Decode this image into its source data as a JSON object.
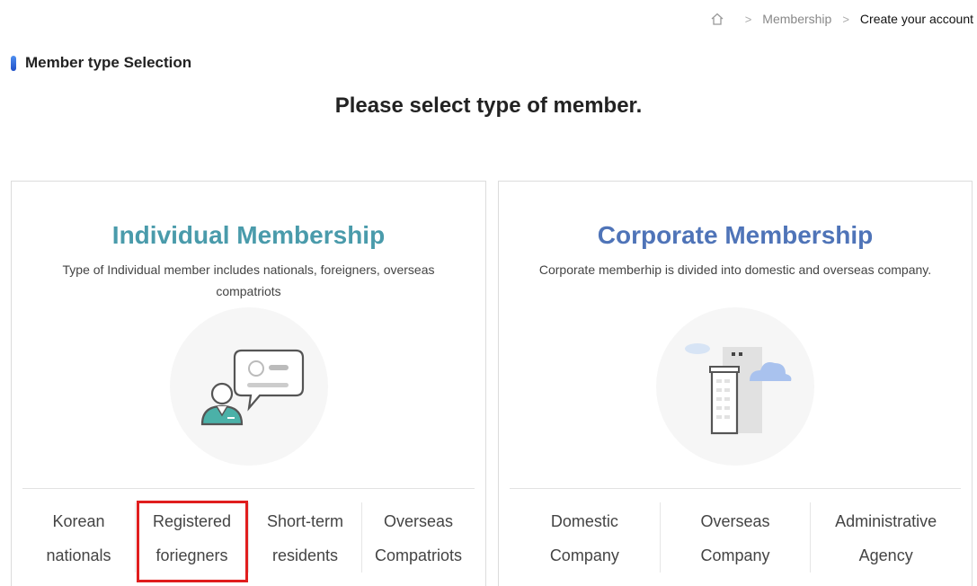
{
  "breadcrumb": {
    "home_icon": "home-icon",
    "separator": ">",
    "items": [
      "Membership",
      "Create your account"
    ]
  },
  "section_title": "Member type Selection",
  "page_title": "Please select type of member.",
  "colors": {
    "individual_title": "#4a9bab",
    "corporate_title": "#4f74b8",
    "highlight": "#e01e1e",
    "section_bar": "#1f4fc7"
  },
  "individual": {
    "title": "Individual Membership",
    "description": "Type of Individual member includes nationals, foreigners, overseas compatriots",
    "icon": "person-chat-icon",
    "types": [
      {
        "line1": "Korean",
        "line2": "nationals"
      },
      {
        "line1": "Registered",
        "line2": "foriegners",
        "highlighted": true
      },
      {
        "line1": "Short-term",
        "line2": "residents"
      },
      {
        "line1": "Overseas",
        "line2": "Compatriots"
      }
    ]
  },
  "corporate": {
    "title": "Corporate Membership",
    "description": "Corporate memberhip is divided into domestic and overseas company.",
    "icon": "building-cloud-icon",
    "types": [
      {
        "line1": "Domestic",
        "line2": "Company"
      },
      {
        "line1": "Overseas",
        "line2": "Company"
      },
      {
        "line1": "Administrative",
        "line2": "Agency"
      }
    ]
  }
}
